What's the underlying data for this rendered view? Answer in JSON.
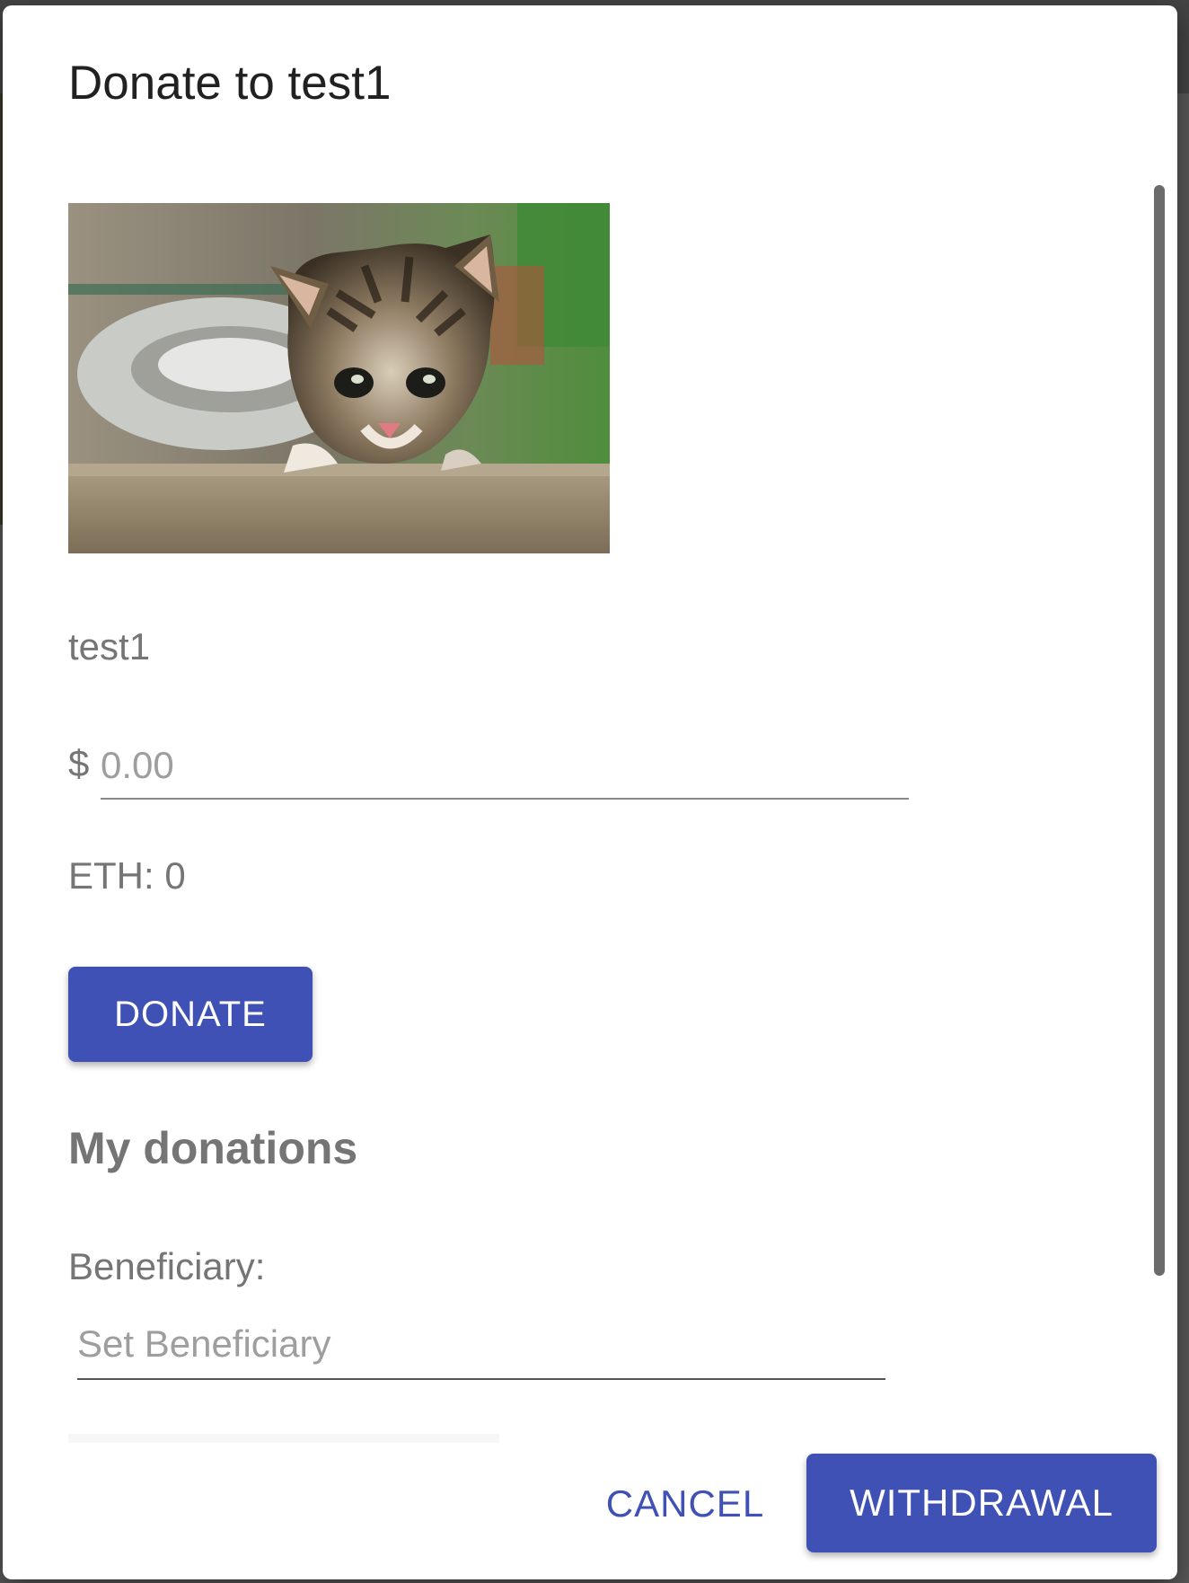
{
  "dialog": {
    "title": "Donate to test1"
  },
  "item": {
    "name": "test1",
    "image_icon": "kitten-photo"
  },
  "donation": {
    "currency_symbol": "$",
    "amount_placeholder": "0.00",
    "eth_text": "ETH: 0",
    "donate_label": "DONATE"
  },
  "my_donations": {
    "heading": "My donations",
    "beneficiary_label": "Beneficiary:",
    "beneficiary_placeholder": "Set Beneficiary"
  },
  "actions": {
    "cancel_label": "CANCEL",
    "withdrawal_label": "WITHDRAWAL"
  },
  "colors": {
    "primary": "#3f51b5",
    "text_secondary": "#757575"
  }
}
